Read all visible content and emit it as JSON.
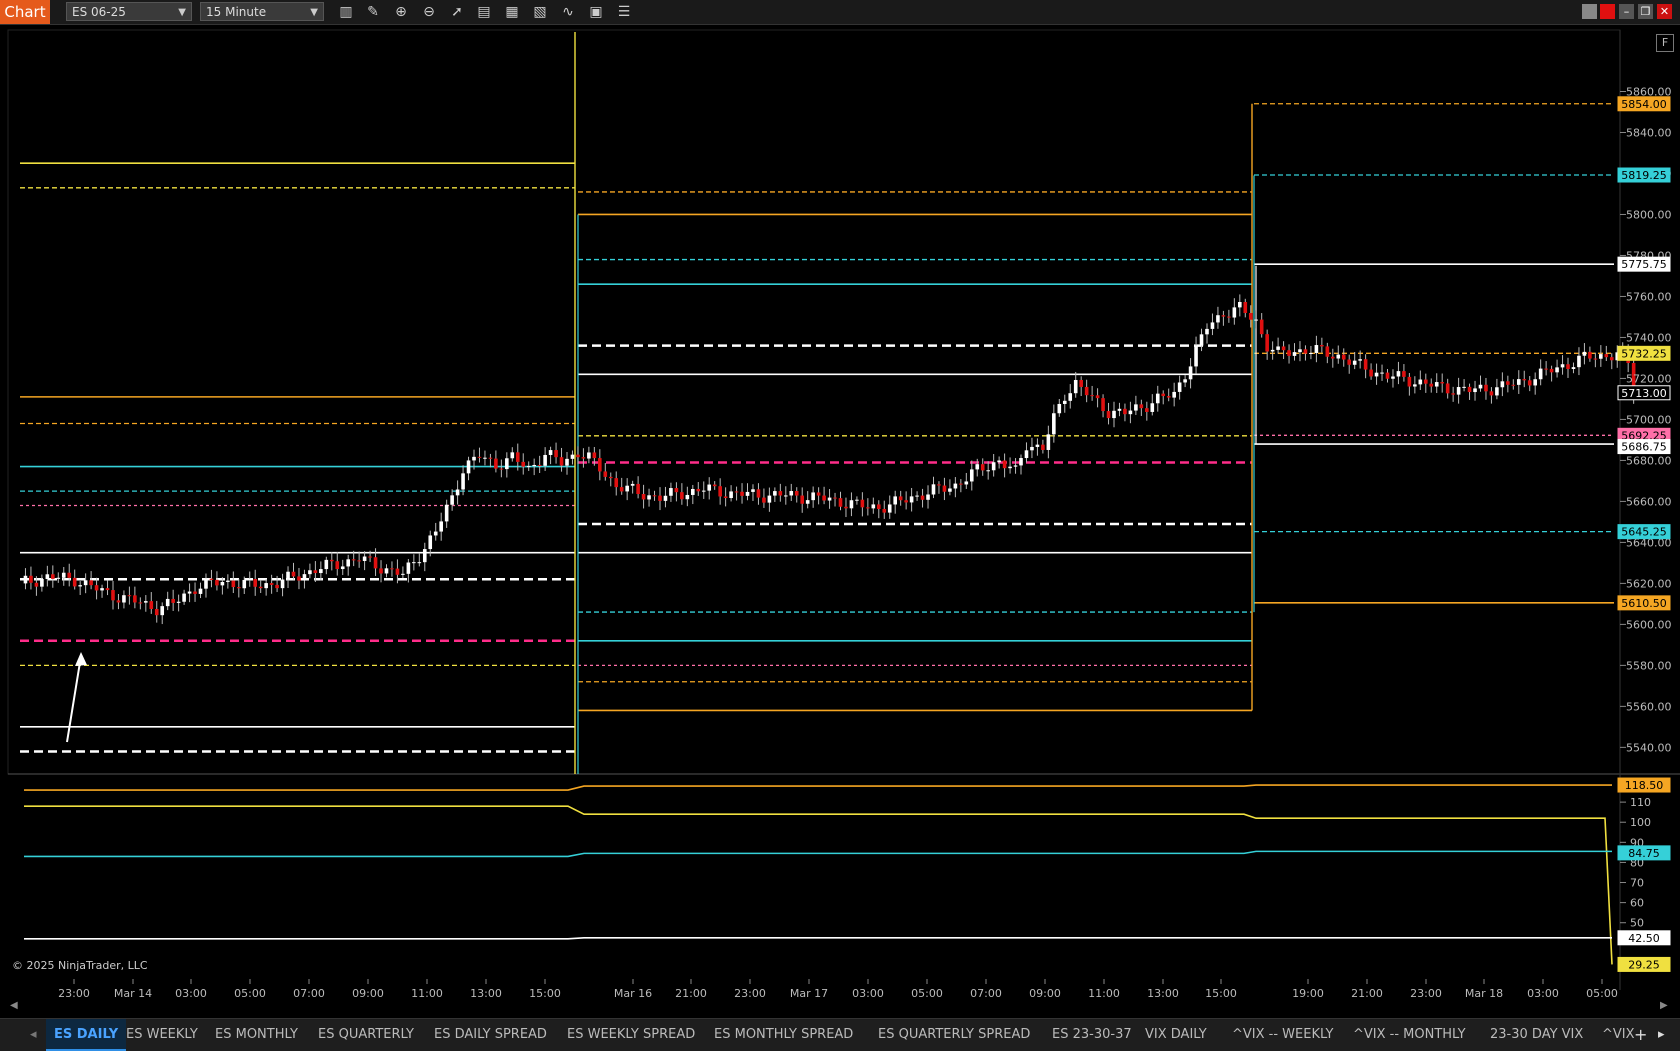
{
  "toolbar": {
    "app_label": "Chart",
    "instrument": "ES 06-25",
    "interval": "15 Minute",
    "icons": [
      "bar-type-icon",
      "pencil-icon",
      "zoom-in-icon",
      "zoom-out-icon",
      "pointer-icon",
      "data-box-icon",
      "chart-style-icon",
      "indicators-icon",
      "strategies-icon",
      "properties-icon",
      "list-icon"
    ]
  },
  "side_button": "F",
  "copyright": "© 2025 NinjaTrader, LLC",
  "tabs": [
    {
      "label": "ES DAILY",
      "active": true
    },
    {
      "label": "ES WEEKLY"
    },
    {
      "label": "ES MONTHLY"
    },
    {
      "label": "ES QUARTERLY"
    },
    {
      "label": "ES DAILY SPREAD"
    },
    {
      "label": "ES WEEKLY SPREAD"
    },
    {
      "label": "ES MONTHLY SPREAD"
    },
    {
      "label": "ES QUARTERLY SPREAD"
    },
    {
      "label": "ES 23-30-37"
    },
    {
      "label": "VIX DAILY"
    },
    {
      "label": "^VIX -- WEEKLY"
    },
    {
      "label": "^VIX -- MONTHLY"
    },
    {
      "label": "23-30 DAY VIX"
    },
    {
      "label": "^VIX"
    }
  ],
  "tab_add": "+",
  "colors": {
    "orange": "#f5a623",
    "yellow": "#f0e040",
    "cyan": "#35d0d8",
    "white": "#ffffff",
    "magenta": "#ff2d8a",
    "pink": "#ff6fa8",
    "up": "#ffffff",
    "down": "#e01010"
  },
  "chart_data": [
    {
      "type": "candlestick",
      "title": "ES 06-25 (15 Minute)",
      "x_tick_labels": [
        "23:00",
        "Mar 14",
        "03:00",
        "05:00",
        "07:00",
        "09:00",
        "11:00",
        "13:00",
        "15:00",
        "Mar 16",
        "21:00",
        "23:00",
        "Mar 17",
        "03:00",
        "05:00",
        "07:00",
        "09:00",
        "11:00",
        "13:00",
        "15:00",
        "19:00",
        "21:00",
        "23:00",
        "Mar 18",
        "03:00",
        "05:00"
      ],
      "y_ticks": [
        5540,
        5560,
        5580,
        5600,
        5620,
        5640,
        5660,
        5680,
        5700,
        5720,
        5740,
        5760,
        5780,
        5800,
        5820,
        5840,
        5860
      ],
      "ylim": [
        5527,
        5890
      ],
      "price_markers": [
        {
          "value": "5854.00",
          "color": "orange"
        },
        {
          "value": "5819.25",
          "color": "cyan"
        },
        {
          "value": "5775.75",
          "color": "white"
        },
        {
          "value": "5732.25",
          "color": "yellow"
        },
        {
          "value": "5713.00",
          "color": "black"
        },
        {
          "value": "5692.25",
          "color": "pink"
        },
        {
          "value": "5686.75",
          "color": "white"
        },
        {
          "value": "5645.25",
          "color": "cyan"
        },
        {
          "value": "5610.50",
          "color": "orange"
        }
      ],
      "close_path": [
        [
          0,
          5620
        ],
        [
          5,
          5623
        ],
        [
          10,
          5622
        ],
        [
          15,
          5616
        ],
        [
          20,
          5612
        ],
        [
          25,
          5608
        ],
        [
          28,
          5610
        ],
        [
          32,
          5618
        ],
        [
          37,
          5621
        ],
        [
          42,
          5619
        ],
        [
          47,
          5620
        ],
        [
          52,
          5625
        ],
        [
          57,
          5629
        ],
        [
          62,
          5632
        ],
        [
          66,
          5628
        ],
        [
          70,
          5624
        ],
        [
          73,
          5634
        ],
        [
          76,
          5645
        ],
        [
          79,
          5662
        ],
        [
          81,
          5676
        ],
        [
          84,
          5682
        ],
        [
          87,
          5678
        ],
        [
          90,
          5681
        ],
        [
          93,
          5676
        ],
        [
          96,
          5683
        ],
        [
          99,
          5679
        ],
        [
          102,
          5684
        ],
        [
          104,
          5681
        ],
        [
          106,
          5676
        ],
        [
          109,
          5668
        ],
        [
          113,
          5664
        ],
        [
          117,
          5662
        ],
        [
          121,
          5664
        ],
        [
          125,
          5666
        ],
        [
          130,
          5664
        ],
        [
          135,
          5663
        ],
        [
          140,
          5663
        ],
        [
          145,
          5662
        ],
        [
          150,
          5660
        ],
        [
          155,
          5657
        ],
        [
          159,
          5658
        ],
        [
          163,
          5662
        ],
        [
          167,
          5665
        ],
        [
          171,
          5668
        ],
        [
          175,
          5675
        ],
        [
          179,
          5680
        ],
        [
          182,
          5674
        ],
        [
          184,
          5688
        ],
        [
          187,
          5686
        ],
        [
          189,
          5700
        ],
        [
          191,
          5712
        ],
        [
          193,
          5718
        ],
        [
          196,
          5710
        ],
        [
          199,
          5704
        ],
        [
          202,
          5703
        ],
        [
          205,
          5706
        ],
        [
          208,
          5710
        ],
        [
          211,
          5712
        ],
        [
          214,
          5728
        ],
        [
          217,
          5745
        ],
        [
          220,
          5752
        ],
        [
          223,
          5754
        ],
        [
          226,
          5748
        ],
        [
          228,
          5736
        ],
        [
          230,
          5732
        ],
        [
          232,
          5733
        ],
        [
          235,
          5734
        ],
        [
          238,
          5733
        ],
        [
          241,
          5731
        ],
        [
          244,
          5727
        ],
        [
          247,
          5724
        ],
        [
          250,
          5721
        ],
        [
          253,
          5720
        ],
        [
          256,
          5718
        ],
        [
          259,
          5716
        ],
        [
          262,
          5715
        ],
        [
          265,
          5714
        ],
        [
          268,
          5715
        ],
        [
          271,
          5716
        ],
        [
          274,
          5718
        ],
        [
          277,
          5721
        ],
        [
          280,
          5724
        ],
        [
          283,
          5727
        ],
        [
          286,
          5730
        ],
        [
          289,
          5731
        ],
        [
          292,
          5732
        ],
        [
          294,
          5727
        ],
        [
          295,
          5713
        ]
      ],
      "levels": [
        {
          "seg": 0,
          "v": 5825,
          "color": "yellow",
          "style": "solid"
        },
        {
          "seg": 0,
          "v": 5813,
          "color": "yellow",
          "style": "dash"
        },
        {
          "seg": 0,
          "v": 5711,
          "color": "orange",
          "style": "solid"
        },
        {
          "seg": 0,
          "v": 5698,
          "color": "orange",
          "style": "dash"
        },
        {
          "seg": 0,
          "v": 5677,
          "color": "cyan",
          "style": "solid"
        },
        {
          "seg": 0,
          "v": 5665,
          "color": "cyan",
          "style": "dash"
        },
        {
          "seg": 0,
          "v": 5658,
          "color": "pink",
          "style": "dot"
        },
        {
          "seg": 0,
          "v": 5635,
          "color": "white",
          "style": "solid"
        },
        {
          "seg": 0,
          "v": 5622,
          "color": "white",
          "style": "bigdash"
        },
        {
          "seg": 0,
          "v": 5592,
          "color": "magenta",
          "style": "bigdash"
        },
        {
          "seg": 0,
          "v": 5580,
          "color": "yellow",
          "style": "dash"
        },
        {
          "seg": 0,
          "v": 5550,
          "color": "white",
          "style": "solid"
        },
        {
          "seg": 0,
          "v": 5538,
          "color": "white",
          "style": "bigdash"
        },
        {
          "seg": 1,
          "v": 5811,
          "color": "orange",
          "style": "dash"
        },
        {
          "seg": 1,
          "v": 5800,
          "color": "orange",
          "style": "solid"
        },
        {
          "seg": 1,
          "v": 5778,
          "color": "cyan",
          "style": "dash"
        },
        {
          "seg": 1,
          "v": 5766,
          "color": "cyan",
          "style": "solid"
        },
        {
          "seg": 1,
          "v": 5736,
          "color": "white",
          "style": "bigdash"
        },
        {
          "seg": 1,
          "v": 5722,
          "color": "white",
          "style": "solid"
        },
        {
          "seg": 1,
          "v": 5692,
          "color": "yellow",
          "style": "dash"
        },
        {
          "seg": 1,
          "v": 5679,
          "color": "magenta",
          "style": "bigdash"
        },
        {
          "seg": 1,
          "v": 5649,
          "color": "white",
          "style": "bigdash"
        },
        {
          "seg": 1,
          "v": 5635,
          "color": "white",
          "style": "solid"
        },
        {
          "seg": 1,
          "v": 5606,
          "color": "cyan",
          "style": "dash"
        },
        {
          "seg": 1,
          "v": 5592,
          "color": "cyan",
          "style": "solid"
        },
        {
          "seg": 1,
          "v": 5580,
          "color": "pink",
          "style": "dot"
        },
        {
          "seg": 1,
          "v": 5572,
          "color": "orange",
          "style": "dash"
        },
        {
          "seg": 1,
          "v": 5558,
          "color": "orange",
          "style": "solid"
        },
        {
          "seg": 2,
          "v": 5854,
          "color": "orange",
          "style": "dash"
        },
        {
          "seg": 2,
          "v": 5819.25,
          "color": "cyan",
          "style": "dash"
        },
        {
          "seg": 2,
          "v": 5775.75,
          "color": "white",
          "style": "solid"
        },
        {
          "seg": 2,
          "v": 5732.25,
          "color": "orange",
          "style": "dash"
        },
        {
          "seg": 2,
          "v": 5692.25,
          "color": "pink",
          "style": "dot"
        },
        {
          "seg": 2,
          "v": 5688,
          "color": "white",
          "style": "solid"
        },
        {
          "seg": 2,
          "v": 5645.25,
          "color": "cyan",
          "style": "dash"
        },
        {
          "seg": 2,
          "v": 5610.5,
          "color": "orange",
          "style": "solid"
        }
      ]
    },
    {
      "type": "line",
      "y_ticks": [
        50,
        60,
        70,
        80,
        90,
        100,
        110
      ],
      "ylim": [
        22,
        122
      ],
      "price_markers": [
        {
          "value": "118.50",
          "color": "orange"
        },
        {
          "value": "84.75",
          "color": "cyan"
        },
        {
          "value": "42.50",
          "color": "white"
        },
        {
          "value": "29.25",
          "color": "yellow"
        }
      ],
      "series": [
        {
          "color": "orange",
          "segments": [
            [
              0,
              116
            ],
            [
              1,
              118
            ],
            [
              2,
              118.5
            ]
          ]
        },
        {
          "color": "yellow",
          "segments": [
            [
              0,
              108
            ],
            [
              1,
              104
            ],
            [
              2,
              102
            ]
          ],
          "end_drop": 29.25
        },
        {
          "color": "cyan",
          "segments": [
            [
              0,
              83
            ],
            [
              1,
              84.5
            ],
            [
              2,
              85.5
            ]
          ],
          "end": 84.75
        },
        {
          "color": "white",
          "segments": [
            [
              0,
              42
            ],
            [
              1,
              42.5
            ],
            [
              2,
              42.5
            ]
          ]
        }
      ]
    }
  ]
}
